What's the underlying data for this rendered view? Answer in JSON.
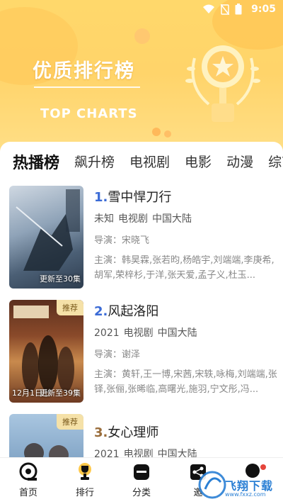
{
  "status": {
    "time": "9:05"
  },
  "banner": {
    "title": "优质排行榜",
    "subtitle": "TOP CHARTS"
  },
  "tabs": [
    {
      "label": "热播榜",
      "active": true
    },
    {
      "label": "飙升榜"
    },
    {
      "label": "电视剧"
    },
    {
      "label": "电影"
    },
    {
      "label": "动漫"
    },
    {
      "label": "综艺"
    }
  ],
  "items": [
    {
      "rank": "1.",
      "title": "雪中悍刀行",
      "year": "未知",
      "genre": "电视剧",
      "region": "中国大陆",
      "director": "导演：宋晓飞",
      "cast": "主演：韩昊霖,张若昀,杨皓宇,刘端端,李庚希,胡军,荣梓杉,于洋,张天爱,孟子义,杜玉...",
      "poster_text": "更新至30集",
      "badge": ""
    },
    {
      "rank": "2.",
      "title": "风起洛阳",
      "year": "2021",
      "genre": "电视剧",
      "region": "中国大陆",
      "director": "导演：谢泽",
      "cast": "主演：黄轩,王一博,宋茜,宋轶,咏梅,刘端端,张铎,张俪,张晞临,高曙光,施羽,宁文彤,冯...",
      "poster_text": "更新至39集",
      "poster_left": "12月1日上",
      "badge": "推荐"
    },
    {
      "rank": "3.",
      "title": "女心理师",
      "year": "2021",
      "genre": "电视剧",
      "region": "中国大陆",
      "director": "",
      "cast": "",
      "poster_text": "",
      "badge": "推荐"
    }
  ],
  "nav": [
    {
      "label": "首页",
      "icon": "home-icon"
    },
    {
      "label": "排行",
      "icon": "trophy-icon"
    },
    {
      "label": "分类",
      "icon": "category-icon"
    },
    {
      "label": "邀",
      "icon": "share-icon"
    },
    {
      "label": "",
      "icon": "profile-icon"
    }
  ],
  "watermark": {
    "text": "飞翔下载",
    "url": "www.fxxz.com"
  },
  "colors": {
    "banner": "#ffd86b",
    "rank_blue": "#3b6bd6",
    "rank_brown": "#9a6d3b"
  }
}
